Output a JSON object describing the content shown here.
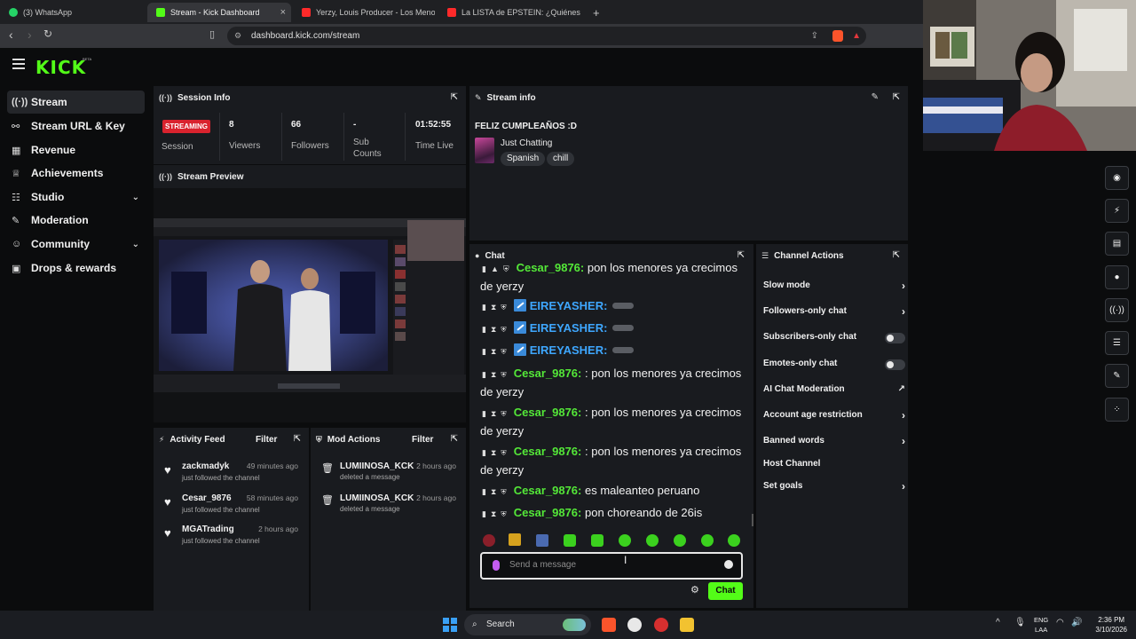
{
  "browser": {
    "tabs": [
      {
        "label": "(3) WhatsApp",
        "color": "#25d366"
      },
      {
        "label": "Stream - Kick Dashboard",
        "color": "#53fc18",
        "active": true
      },
      {
        "label": "Yerzy, Louis Producer - Los Meno",
        "color": "#ff2a2a"
      },
      {
        "label": "La LISTA de EPSTEIN: ¿Quiénes están",
        "color": "#ff2a2a"
      }
    ],
    "new_tab": "+",
    "close": "×",
    "url": "dashboard.kick.com/stream"
  },
  "kick": {
    "logo": "KICK",
    "beta": "BETA"
  },
  "sidebar": {
    "items": [
      {
        "label": "Stream",
        "icon": "broadcast-icon",
        "glyph": "((·))"
      },
      {
        "label": "Stream URL & Key",
        "icon": "link-icon",
        "glyph": "🔗"
      },
      {
        "label": "Revenue",
        "icon": "calendar-icon",
        "glyph": "▦"
      },
      {
        "label": "Achievements",
        "icon": "trophy-icon",
        "glyph": "🏆"
      },
      {
        "label": "Studio",
        "icon": "sliders-icon",
        "glyph": "☷"
      },
      {
        "label": "Moderation",
        "icon": "wrench-icon",
        "glyph": "🔧"
      },
      {
        "label": "Community",
        "icon": "users-icon",
        "glyph": "👥"
      },
      {
        "label": "Drops & rewards",
        "icon": "gift-icon",
        "glyph": "▣"
      }
    ]
  },
  "session": {
    "title": "Session Info",
    "badge": "STREAMING",
    "badge_label": "Session",
    "stats": [
      {
        "value": "8",
        "label": "Viewers"
      },
      {
        "value": "66",
        "label": "Followers"
      },
      {
        "value": "-",
        "label": "Sub\nCounts"
      },
      {
        "value": "01:52:55",
        "label": "Time Live"
      }
    ]
  },
  "stream_info": {
    "title": "Stream info",
    "stream_title": "FELIZ CUMPLEAÑOS :D",
    "category": "Just Chatting",
    "tags": [
      "Spanish",
      "chill"
    ]
  },
  "preview": {
    "title": "Stream Preview"
  },
  "activity": {
    "title": "Activity Feed",
    "filter": "Filter",
    "items": [
      {
        "name": "zackmadyk",
        "time": "49 minutes ago",
        "desc": "just followed the channel"
      },
      {
        "name": "Cesar_9876",
        "time": "58 minutes ago",
        "desc": "just followed the channel"
      },
      {
        "name": "MGATrading",
        "time": "2 hours ago",
        "desc": "just followed the channel"
      }
    ]
  },
  "mod_actions": {
    "title": "Mod Actions",
    "filter": "Filter",
    "items": [
      {
        "name": "LUMIINOSA_KCK",
        "time": "2 hours ago",
        "desc": "deleted a message"
      },
      {
        "name": "LUMIINOSA_KCK",
        "time": "2 hours ago",
        "desc": "deleted a message"
      }
    ]
  },
  "chat": {
    "title": "Chat",
    "messages": [
      {
        "user": "Cesar_9876:",
        "text": "pon los menores ya crecimos de yerzy",
        "color": "green"
      },
      {
        "user": "EIREYASHER:",
        "text": "",
        "color": "blue"
      },
      {
        "user": "EIREYASHER:",
        "text": "",
        "color": "blue"
      },
      {
        "user": "EIREYASHER:",
        "text": "",
        "color": "blue"
      },
      {
        "user": "Cesar_9876:",
        "text": ": pon los menores ya crecimos de yerzy",
        "color": "green"
      },
      {
        "user": "Cesar_9876:",
        "text": ": pon los menores ya crecimos de yerzy",
        "color": "green"
      },
      {
        "user": "Cesar_9876:",
        "text": ": pon los menores ya crecimos de yerzy",
        "color": "green"
      },
      {
        "user": "Cesar_9876:",
        "text": "es maleanteo peruano",
        "color": "green"
      },
      {
        "user": "Cesar_9876:",
        "text": "pon choreando de 26is",
        "color": "green"
      }
    ],
    "placeholder": "Send a message",
    "send_label": "Chat"
  },
  "channel_actions": {
    "title": "Channel Actions",
    "items": [
      {
        "label": "Slow mode",
        "control": "arrow"
      },
      {
        "label": "Followers-only chat",
        "control": "arrow"
      },
      {
        "label": "Subscribers-only chat",
        "control": "toggle"
      },
      {
        "label": "Emotes-only chat",
        "control": "toggle"
      },
      {
        "label": "AI Chat Moderation",
        "control": "external"
      },
      {
        "label": "Account age restriction",
        "control": "arrow"
      },
      {
        "label": "Banned words",
        "control": "arrow"
      },
      {
        "label": "Host Channel",
        "control": "none"
      },
      {
        "label": "Set goals",
        "control": "arrow"
      }
    ]
  },
  "taskbar": {
    "search": "Search",
    "lang_top": "ENG",
    "lang_bottom": "LAA",
    "time": "2:36 PM",
    "date": "3/10/2026"
  },
  "colors": {
    "kick_green": "#53fc18",
    "streaming_red": "#d9232e",
    "chat_green_user": "#54e838",
    "chat_blue_user": "#3ea7ff"
  }
}
